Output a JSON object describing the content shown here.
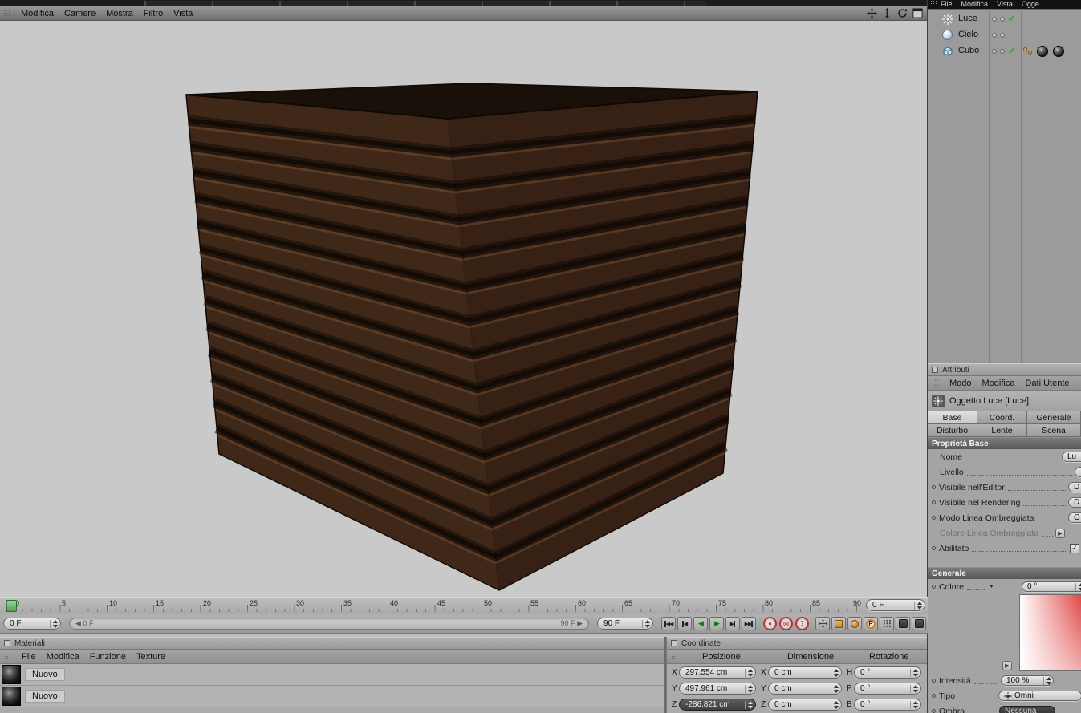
{
  "icons": {
    "check": "✓",
    "caret_down": "▼",
    "arrow_right": "▶",
    "arrow_left": "◀",
    "skip_start": "◀◀",
    "step_back": "◀",
    "play_back": "◀",
    "play_fwd": "▶",
    "step_fwd": "▶",
    "skip_end": "▶▶",
    "record_a": "●",
    "record_b": "◎",
    "record_c": "?",
    "p_letter": "P"
  },
  "top_toolbar_menu": {
    "items": [
      "File",
      "Modifica",
      "Vista",
      "Ogge"
    ]
  },
  "viewport_menu": {
    "items": [
      "Modifica",
      "Camere",
      "Mostra",
      "Filtro",
      "Vista"
    ]
  },
  "object_manager": {
    "items": [
      {
        "label": "Luce"
      },
      {
        "label": "Cielo"
      },
      {
        "label": "Cubo"
      }
    ]
  },
  "attributes": {
    "panel_title": "Attributi",
    "menu": [
      "Modo",
      "Modifica",
      "Dati Utente"
    ],
    "object_title": "Oggetto Luce [Luce]",
    "active_tab": "Base",
    "tabs": [
      {
        "label": "Base"
      },
      {
        "label": "Coord."
      },
      {
        "label": "Generale"
      },
      {
        "label": "Disturbo"
      },
      {
        "label": "Lente"
      },
      {
        "label": "Scena"
      }
    ],
    "base": {
      "header": "Proprietà Base",
      "rows": [
        {
          "label": "Nome",
          "value": "Lu"
        },
        {
          "label": "Livello",
          "value": ""
        },
        {
          "label": "Visibile nell'Editor",
          "value": "D"
        },
        {
          "label": "Visibile nel Rendering",
          "value": "D"
        },
        {
          "label": "Modo Linea Ombreggiata",
          "value": "O"
        },
        {
          "label": "Colore Linea Ombreggiata",
          "value": "▶"
        },
        {
          "label": "Abilitato",
          "value": "✓"
        }
      ]
    },
    "general": {
      "header": "Generale",
      "colore_label": "Colore",
      "hue_value": "0 °",
      "intensita_label": "Intensità",
      "intensita_value": "100 %",
      "tipo_label": "Tipo",
      "tipo_value": "Omni",
      "ombra_label": "Ombra",
      "ombra_value": "Nessuna"
    }
  },
  "timeline": {
    "labels": [
      "0",
      "5",
      "10",
      "15",
      "20",
      "25",
      "30",
      "35",
      "40",
      "45",
      "50",
      "55",
      "60",
      "65",
      "70",
      "75",
      "80",
      "85",
      "90"
    ],
    "current": "0 F"
  },
  "transport": {
    "frame": "0 F",
    "range_start": "0 F",
    "range_end": "90 F",
    "end": "90 F"
  },
  "materials": {
    "panel_title": "Materiali",
    "menu": [
      "File",
      "Modifica",
      "Funzione",
      "Texture"
    ],
    "items": [
      {
        "label": "Nuovo"
      },
      {
        "label": "Nuovo"
      }
    ]
  },
  "coordinates": {
    "panel_title": "Coordinate",
    "columns": [
      "Posizione",
      "Dimensione",
      "Rotazione"
    ],
    "rows": [
      {
        "pl": "X",
        "pv": "297.554 cm",
        "dl": "X",
        "dv": "0 cm",
        "rl": "H",
        "rv": "0 °"
      },
      {
        "pl": "Y",
        "pv": "497.961 cm",
        "dl": "Y",
        "dv": "0 cm",
        "rl": "P",
        "rv": "0 °"
      },
      {
        "pl": "Z",
        "pv": "-286.821 cm",
        "dl": "Z",
        "dv": "0 cm",
        "rl": "B",
        "rv": "0 °"
      }
    ]
  }
}
